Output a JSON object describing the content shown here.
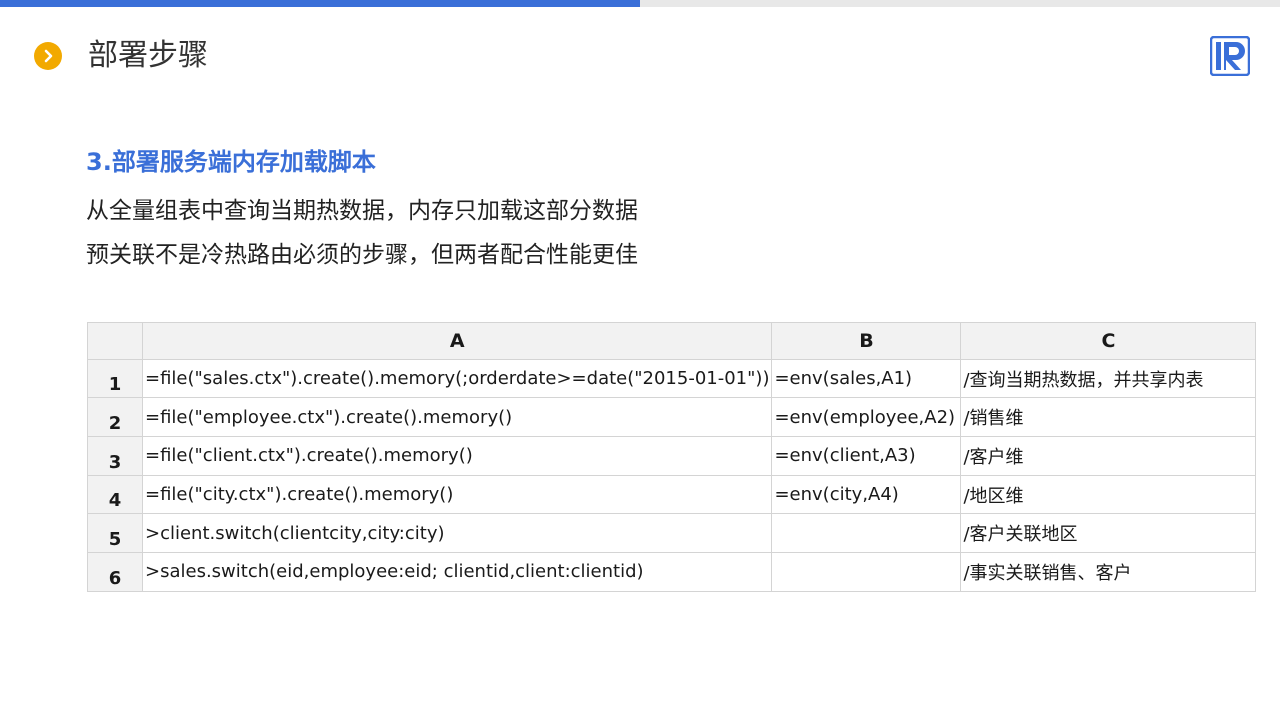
{
  "header": {
    "title": "部署步骤",
    "accent_color": "#3a6fd8",
    "icon_color": "#f2a900"
  },
  "section": {
    "title": "3.部署服务端内存加载脚本",
    "lines": [
      "从全量组表中查询当期热数据，内存只加载这部分数据",
      "预关联不是冷热路由必须的步骤，但两者配合性能更佳"
    ]
  },
  "grid": {
    "columns": [
      "A",
      "B",
      "C"
    ],
    "rows": [
      {
        "num": "1",
        "A": "=file(\"sales.ctx\").create().memory(;orderdate>=date(\"2015-01-01\"))",
        "B": "=env(sales,A1)",
        "C": "/查询当期热数据，并共享内表"
      },
      {
        "num": "2",
        "A": "=file(\"employee.ctx\").create().memory()",
        "B": "=env(employee,A2)",
        "C": "/销售维"
      },
      {
        "num": "3",
        "A": "=file(\"client.ctx\").create().memory()",
        "B": "=env(client,A3)",
        "C": "/客户维"
      },
      {
        "num": "4",
        "A": "=file(\"city.ctx\").create().memory()",
        "B": "=env(city,A4)",
        "C": "/地区维"
      },
      {
        "num": "5",
        "A": ">client.switch(clientcity,city:city)",
        "B": "",
        "C": "/客户关联地区"
      },
      {
        "num": "6",
        "A": ">sales.switch(eid,employee:eid; clientid,client:clientid)",
        "B": "",
        "C": "/事实关联销售、客户"
      }
    ]
  }
}
